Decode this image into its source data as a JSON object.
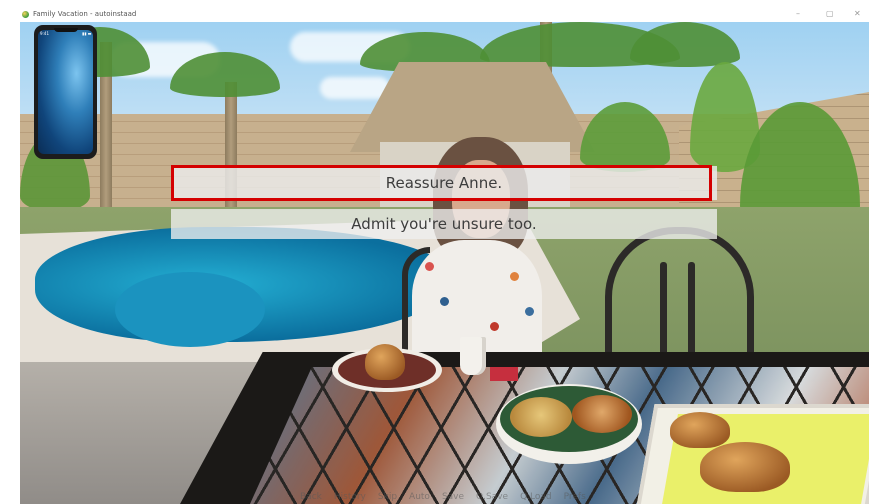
{
  "window": {
    "title": "Family Vacation - autoinstaad",
    "controls": [
      "–",
      "▢",
      "✕"
    ]
  },
  "phone": {
    "time": "9:41",
    "status": "▮▮ ▬"
  },
  "choices": [
    {
      "label": "Reassure Anne.",
      "highlighted": true
    },
    {
      "label": "Admit you're unsure too.",
      "highlighted": false
    }
  ],
  "highlight_color": "#d40000",
  "quick_menu": [
    "Back",
    "History",
    "Skip",
    "Auto",
    "Save",
    "Q.Save",
    "Q.Load",
    "Prefs"
  ]
}
